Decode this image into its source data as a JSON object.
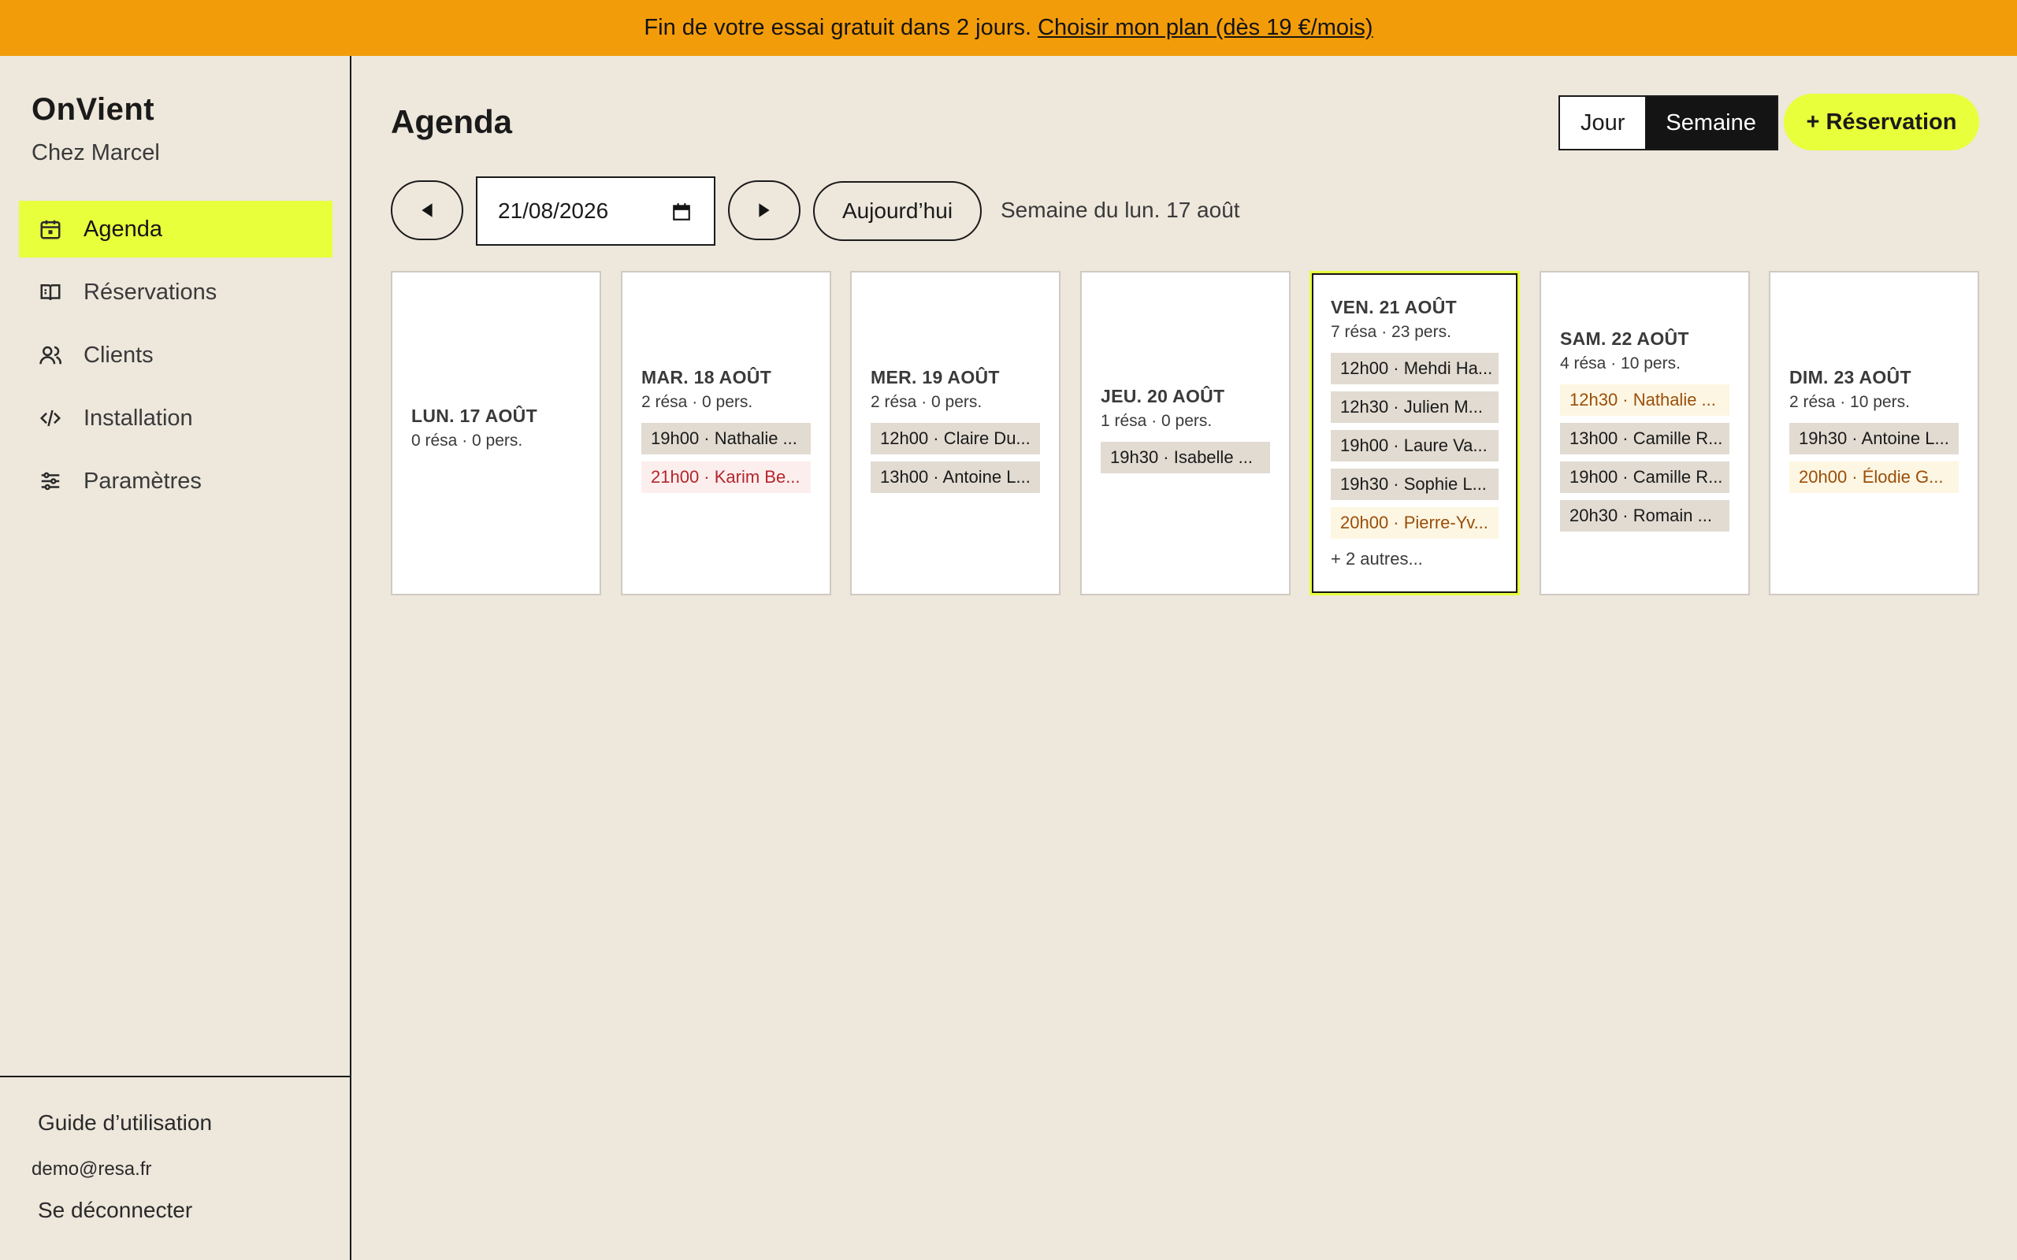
{
  "banner": {
    "text": "Fin de votre essai gratuit dans 2 jours.",
    "link": "Choisir mon plan (dès 19 €/mois)"
  },
  "sidebar": {
    "brand": "OnVient",
    "venue": "Chez Marcel",
    "items": [
      {
        "label": "Agenda",
        "icon": "calendar-icon",
        "active": true
      },
      {
        "label": "Réservations",
        "icon": "book-icon"
      },
      {
        "label": "Clients",
        "icon": "users-icon"
      },
      {
        "label": "Installation",
        "icon": "code-icon"
      },
      {
        "label": "Paramètres",
        "icon": "sliders-icon"
      }
    ],
    "guide": "Guide d’utilisation",
    "email": "demo@resa.fr",
    "logout": "Se déconnecter"
  },
  "main": {
    "title": "Agenda",
    "view_day": "Jour",
    "view_week": "Semaine",
    "new_reservation": "+ Réservation",
    "date_value": "21/08/2026",
    "today": "Aujourd’hui",
    "week_label": "Semaine du lun. 17 août"
  },
  "days": [
    {
      "name": "LUN. 17 AOÛT",
      "stats": "0 résa · 0 pers.",
      "reservations": []
    },
    {
      "name": "MAR. 18 AOÛT",
      "stats": "2 résa · 0 pers.",
      "reservations": [
        {
          "text": "19h00 · Nathalie ...",
          "status": "confirmed"
        },
        {
          "text": "21h00 · Karim Be...",
          "status": "cancelled"
        }
      ]
    },
    {
      "name": "MER. 19 AOÛT",
      "stats": "2 résa · 0 pers.",
      "reservations": [
        {
          "text": "12h00 · Claire Du...",
          "status": "confirmed"
        },
        {
          "text": "13h00 · Antoine L...",
          "status": "confirmed"
        }
      ]
    },
    {
      "name": "JEU. 20 AOÛT",
      "stats": "1 résa · 0 pers.",
      "reservations": [
        {
          "text": "19h30 · Isabelle ...",
          "status": "confirmed"
        }
      ]
    },
    {
      "name": "VEN. 21 AOÛT",
      "stats": "7 résa · 23 pers.",
      "current": true,
      "reservations": [
        {
          "text": "12h00 · Mehdi Ha...",
          "status": "confirmed"
        },
        {
          "text": "12h30 · Julien M...",
          "status": "confirmed"
        },
        {
          "text": "19h00 · Laure Va...",
          "status": "confirmed"
        },
        {
          "text": "19h30 · Sophie L...",
          "status": "confirmed"
        },
        {
          "text": "20h00 · Pierre-Yv...",
          "status": "pending"
        }
      ],
      "more": "+ 2 autres..."
    },
    {
      "name": "SAM. 22 AOÛT",
      "stats": "4 résa · 10 pers.",
      "reservations": [
        {
          "text": "12h30 · Nathalie ...",
          "status": "pending"
        },
        {
          "text": "13h00 · Camille R...",
          "status": "confirmed"
        },
        {
          "text": "19h00 · Camille R...",
          "status": "confirmed"
        },
        {
          "text": "20h30 · Romain ...",
          "status": "confirmed"
        }
      ]
    },
    {
      "name": "DIM. 23 AOÛT",
      "stats": "2 résa · 10 pers.",
      "reservations": [
        {
          "text": "19h30 · Antoine L...",
          "status": "confirmed"
        },
        {
          "text": "20h00 · Élodie G...",
          "status": "pending"
        }
      ]
    }
  ],
  "colors": {
    "banner": "#f39c0a",
    "accent": "#e8ff3c",
    "background": "#ede7dc",
    "confirmed": "#e1dbd1",
    "cancelled_text": "#b3262b",
    "pending_text": "#9a4e0a"
  }
}
